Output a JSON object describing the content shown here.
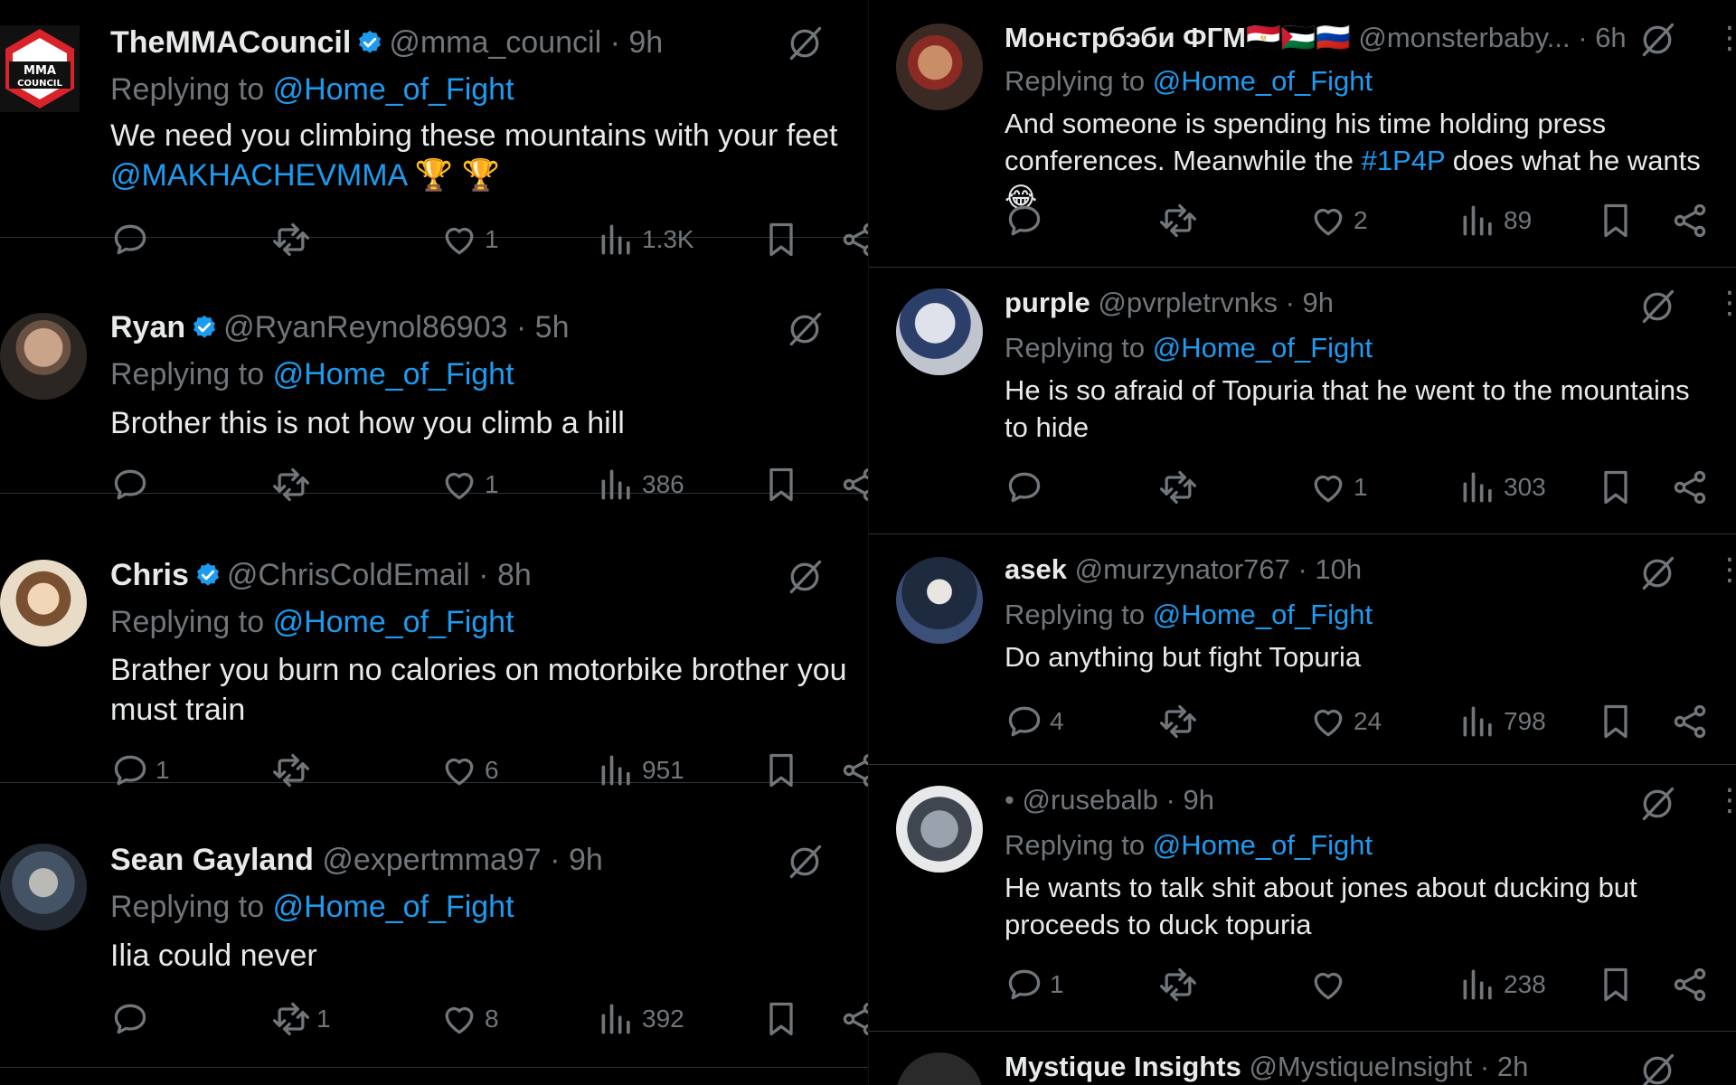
{
  "left_column": {
    "tweets": [
      {
        "name": "TheMMACouncil",
        "verified": true,
        "handle": "@mma_council",
        "time": "9h",
        "replying_prefix": "Replying to",
        "replying_to": "@Home_of_Fight",
        "body_text": "We need you climbing these mountains with your feet",
        "body_mention": "@MAKHACHEVMMA",
        "body_emoji": "🏆 🏆",
        "avatar_text": "MMA COUNCIL",
        "replies": "",
        "reposts": "",
        "likes": "1",
        "views": "1.3K"
      },
      {
        "name": "Ryan",
        "verified": true,
        "handle": "@RyanReynol86903",
        "time": "5h",
        "replying_prefix": "Replying to",
        "replying_to": "@Home_of_Fight",
        "body_text": "Brother this is not how you climb a hill",
        "replies": "",
        "reposts": "",
        "likes": "1",
        "views": "386"
      },
      {
        "name": "Chris",
        "verified": true,
        "handle": "@ChrisColdEmail",
        "time": "8h",
        "replying_prefix": "Replying to",
        "replying_to": "@Home_of_Fight",
        "body_text": "Brather you burn no calories on motorbike brother you must train",
        "replies": "1",
        "reposts": "",
        "likes": "6",
        "views": "951"
      },
      {
        "name": "Sean Gayland",
        "verified": false,
        "handle": "@expertmma97",
        "time": "9h",
        "replying_prefix": "Replying to",
        "replying_to": "@Home_of_Fight",
        "body_text": "Ilia could never",
        "replies": "",
        "reposts": "1",
        "likes": "8",
        "views": "392"
      }
    ]
  },
  "right_column": {
    "tweets": [
      {
        "name": "Монстрбэби ФГМ",
        "flags": "🇪🇬🇵🇸🇷🇺",
        "handle": "@monsterbaby...",
        "time": "6h",
        "replying_prefix": "Replying to",
        "replying_to": "@Home_of_Fight",
        "body_text_a": "And someone is spending his time holding press conferences. Meanwhile the",
        "body_hashtag": "#1P4P",
        "body_text_b": "does what he wants 😂",
        "replies": "",
        "reposts": "",
        "likes": "2",
        "views": "89"
      },
      {
        "name": "purple",
        "handle": "@pvrpletrvnks",
        "time": "9h",
        "replying_prefix": "Replying to",
        "replying_to": "@Home_of_Fight",
        "body_text": "He is so afraid of Topuria that he went to the mountains to hide",
        "replies": "",
        "reposts": "",
        "likes": "1",
        "views": "303"
      },
      {
        "name": "asek",
        "handle": "@murzynator767",
        "time": "10h",
        "replying_prefix": "Replying to",
        "replying_to": "@Home_of_Fight",
        "body_text": "Do anything but fight Topuria",
        "replies": "4",
        "reposts": "",
        "likes": "24",
        "views": "798"
      },
      {
        "name": "•",
        "handle": "@rusebalb",
        "time": "9h",
        "replying_prefix": "Replying to",
        "replying_to": "@Home_of_Fight",
        "body_text": "He wants to talk shit about jones about ducking but proceeds to duck topuria",
        "replies": "1",
        "reposts": "",
        "likes": "",
        "views": "238"
      },
      {
        "name": "Mystique Insights",
        "handle": "@MystiqueInsight",
        "time": "2h"
      }
    ]
  },
  "ui": {
    "separator": "·",
    "more": "⋮"
  },
  "colors": {
    "background": "#000000",
    "text": "#e7e9ea",
    "muted": "#71767b",
    "link": "#1d9bf0",
    "divider": "#2f3336"
  }
}
